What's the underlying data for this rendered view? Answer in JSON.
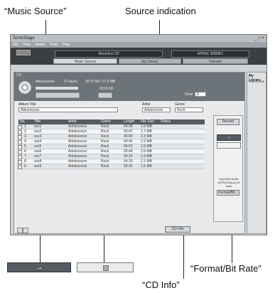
{
  "callouts": {
    "music_source": "“Music Source”",
    "source_indication": "Source indication",
    "format_bitrate": "“Format/Bit Rate”",
    "cd_info": "“CD Info”"
  },
  "app": {
    "title": "SonicStage",
    "menu": [
      "File",
      "View",
      "Action",
      "Tools",
      "Help"
    ],
    "source_display": "Record a CD",
    "device_display": "ATRAC WDRE1",
    "nav": [
      "Music Source",
      "My Library",
      "Transfer"
    ]
  },
  "cd": {
    "label": "CD",
    "album": "Albumxxxxx",
    "tracks": "9 Tracks",
    "total_time": "00:37:58 / 17.3 MB",
    "time_remaining": "00:00:00",
    "drive": "Drive",
    "drive_value": "E",
    "album_title_label": "Album Title",
    "album_title_value": "Albumxxxxx",
    "artist_label": "Artist",
    "artist_value": "Artistxxxxxx",
    "genre_label": "Genre",
    "genre_value": "Rock",
    "record_button": "Record",
    "format_text": "OpenMG Audio (ATRAC3plus) 64 kbps",
    "format_button": "Format/Bit...",
    "cd_info_button": "CD Info"
  },
  "table": {
    "headers": [
      "No.",
      "Title",
      "Artist",
      "Genre",
      "Length",
      "File Size",
      "Status"
    ],
    "rows": [
      [
        "1",
        "xxx1",
        "Artistxxxxxx",
        "Rock",
        "04:08",
        "1.9 MB",
        ""
      ],
      [
        "2",
        "xxx2",
        "Artistxxxxxx",
        "Rock",
        "03:47",
        "1.7 MB",
        ""
      ],
      [
        "3",
        "xxx3",
        "Artistxxxxxx",
        "Rock",
        "05:00",
        "2.3 MB",
        ""
      ],
      [
        "4",
        "xxx4",
        "Artistxxxxxx",
        "Rock",
        "04:42",
        "2.2 MB",
        ""
      ],
      [
        "5",
        "xxx5",
        "Artistxxxxxx",
        "Rock",
        "04:02",
        "1.9 MB",
        ""
      ],
      [
        "6",
        "xxx6",
        "Artistxxxxxx",
        "Rock",
        "05:44",
        "2.6 MB",
        ""
      ],
      [
        "7",
        "xxx7",
        "Artistxxxxxx",
        "Rock",
        "04:14",
        "1.9 MB",
        ""
      ],
      [
        "8",
        "xxx8",
        "Artistxxxxxx",
        "Rock",
        "04:33",
        "2.1 MB",
        ""
      ],
      [
        "9",
        "xxx9",
        "Artistxxxxxx",
        "Rock",
        "03:20",
        "1.5 MB",
        ""
      ]
    ]
  },
  "sidebar": {
    "title": "My Library",
    "free": "Free 8.2 GB"
  },
  "legend": {
    "arrow_symbol": "→"
  }
}
